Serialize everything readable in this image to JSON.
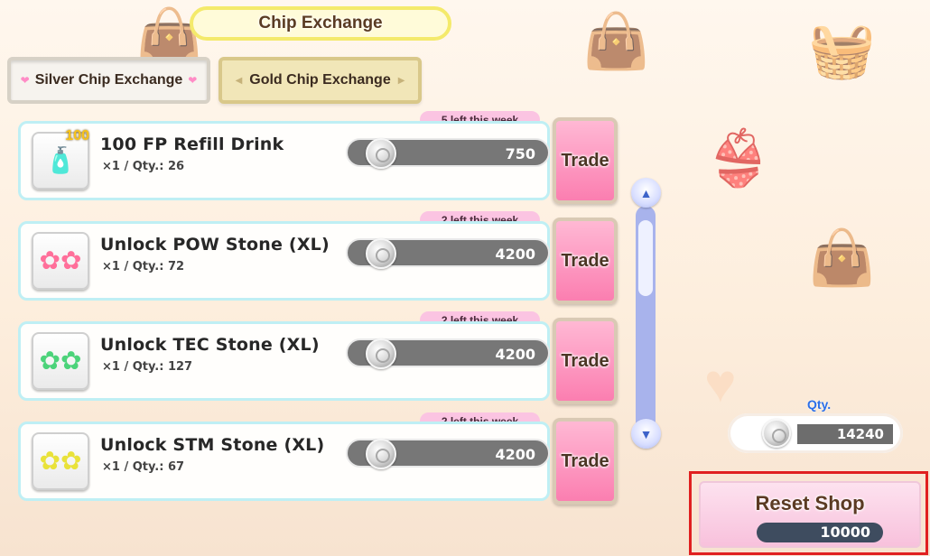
{
  "header": {
    "title": "Chip Exchange"
  },
  "tabs": [
    {
      "label": "Silver Chip Exchange",
      "active": true
    },
    {
      "label": "Gold Chip Exchange",
      "active": false
    }
  ],
  "items": [
    {
      "name": "100 FP Refill Drink",
      "qty_text": "×1  / Qty.: 26",
      "weekly": "5 left this week",
      "price": "750",
      "badge": "100",
      "icon": "drink-icon"
    },
    {
      "name": "Unlock POW Stone (XL)",
      "qty_text": "×1  / Qty.: 72",
      "weekly": "2 left this week",
      "price": "4200",
      "icon": "pink-stone-icon"
    },
    {
      "name": "Unlock TEC Stone (XL)",
      "qty_text": "×1  / Qty.: 127",
      "weekly": "2 left this week",
      "price": "4200",
      "icon": "green-stone-icon"
    },
    {
      "name": "Unlock STM Stone (XL)",
      "qty_text": "×1  / Qty.: 67",
      "weekly": "2 left this week",
      "price": "4200",
      "icon": "yellow-stone-icon"
    }
  ],
  "trade_label": "Trade",
  "wallet": {
    "label": "Qty.",
    "value": "14240"
  },
  "reset": {
    "label": "Reset Shop",
    "cost": "10000"
  },
  "colors": {
    "accent_pink": "#fb7eb0",
    "row_border": "#bfeff4",
    "scroll": "#a8b3ec",
    "highlight": "#e02020"
  }
}
